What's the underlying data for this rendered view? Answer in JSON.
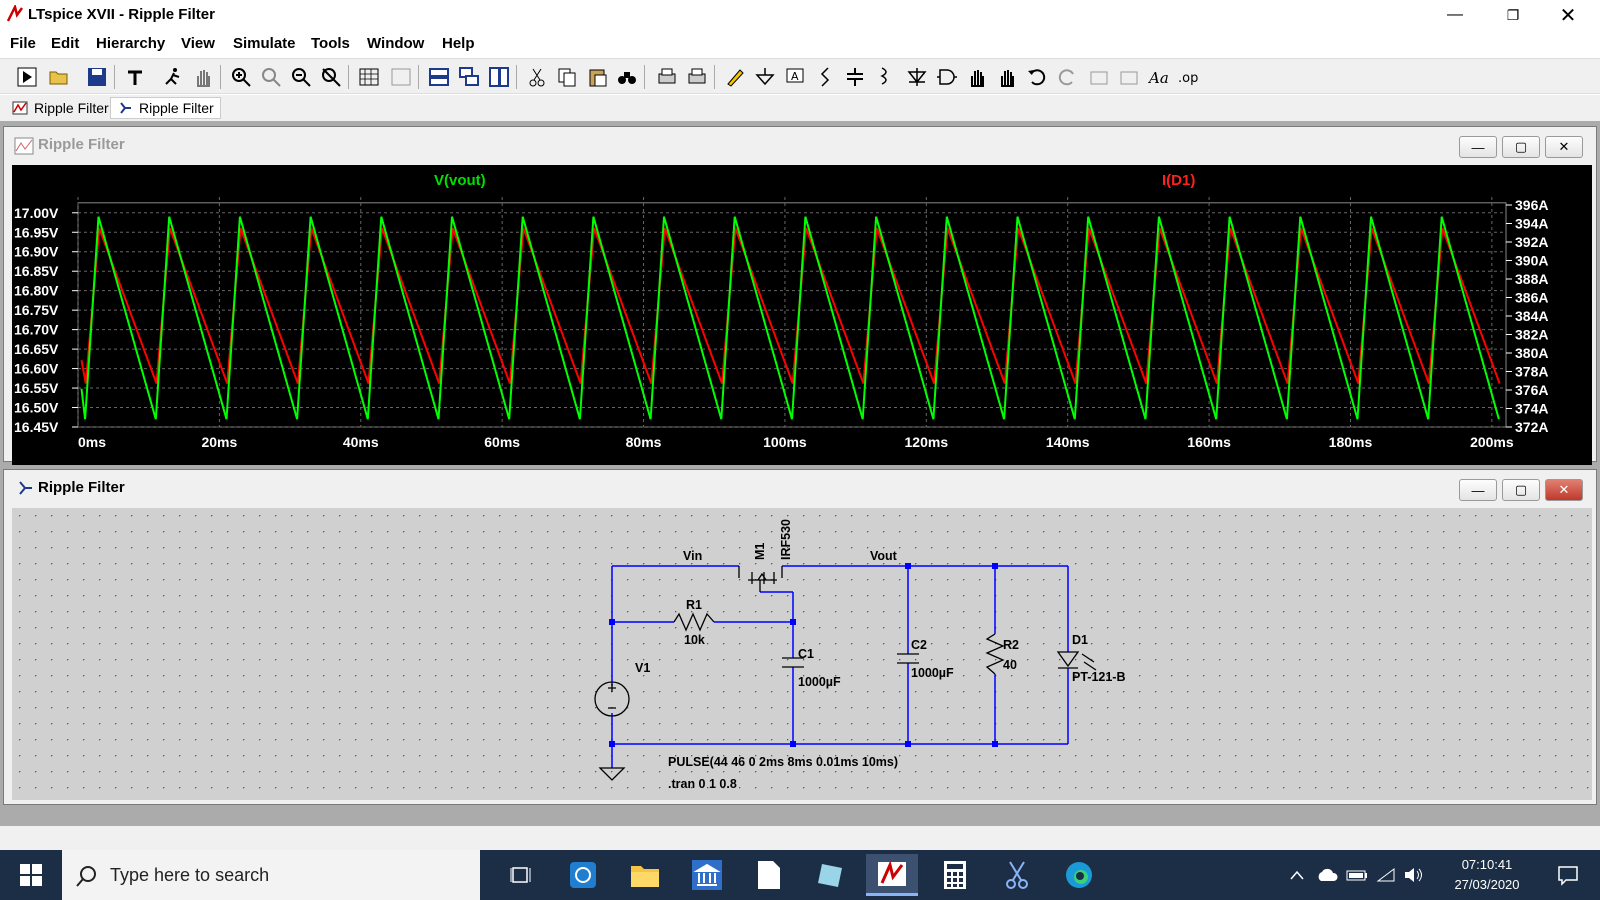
{
  "app": {
    "title": "LTspice XVII - Ripple Filter",
    "window_controls": [
      "minimize-icon",
      "restore-icon",
      "close-icon"
    ]
  },
  "menu": [
    "File",
    "Edit",
    "Hierarchy",
    "View",
    "Simulate",
    "Tools",
    "Window",
    "Help"
  ],
  "tabs": [
    {
      "label": "Ripple Filter",
      "icon": "waveform-icon"
    },
    {
      "label": "Ripple Filter",
      "icon": "schematic-icon"
    }
  ],
  "plot_window": {
    "title": "Ripple Filter",
    "trace1_label": "V(vout)",
    "trace2_label": "I(D1)",
    "colors": {
      "trace1": "#00ff00",
      "trace2": "#ff0000",
      "background": "#000000",
      "axis": "#ffffff"
    }
  },
  "chart_data": {
    "type": "line",
    "x_ticks": [
      "0ms",
      "20ms",
      "40ms",
      "60ms",
      "80ms",
      "100ms",
      "120ms",
      "140ms",
      "160ms",
      "180ms",
      "200ms"
    ],
    "y_left_ticks": [
      "17.00V",
      "16.95V",
      "16.90V",
      "16.85V",
      "16.80V",
      "16.75V",
      "16.70V",
      "16.65V",
      "16.60V",
      "16.55V",
      "16.50V",
      "16.45V"
    ],
    "y_right_ticks": [
      "396A",
      "394A",
      "392A",
      "390A",
      "388A",
      "386A",
      "384A",
      "382A",
      "380A",
      "378A",
      "376A",
      "374A",
      "372A"
    ],
    "xlim": [
      0,
      202
    ],
    "ylim_left": [
      16.45,
      17.02
    ],
    "ylim_right": [
      372,
      396
    ],
    "period_ms": 10,
    "series": [
      {
        "name": "V(vout)",
        "axis": "left",
        "peak_time_offset_ms": 2.9,
        "trough_time_offset_ms": 1.0,
        "max": 16.99,
        "min": 16.47
      },
      {
        "name": "I(D1)",
        "axis": "right",
        "peak_time_offset_ms": 3.0,
        "trough_time_offset_ms": 1.1,
        "max": 393.5,
        "min": 376.7
      }
    ],
    "grid": true
  },
  "schematic_window": {
    "title": "Ripple Filter",
    "labels": {
      "vin": "Vin",
      "vout": "Vout",
      "m1": "M1",
      "m1_model": "IRF530",
      "r1": "R1",
      "r1_value": "10k",
      "c1": "C1",
      "c1_value": "1000µF",
      "c2": "C2",
      "c2_value": "1000µF",
      "r2": "R2",
      "r2_value": "40",
      "d1": "D1",
      "d1_model": "PT-121-B",
      "v1": "V1",
      "v1_value": "PULSE(44 46 0 2ms 8ms 0.01ms 10ms)",
      "directive": ".tran 0 1 0.8"
    },
    "colors": {
      "wire": "#0000ff",
      "component": "#000000",
      "background": "#d0d0d0"
    }
  },
  "taskbar": {
    "search_placeholder": "Type here to search",
    "time": "07:10:41",
    "date": "27/03/2020"
  }
}
